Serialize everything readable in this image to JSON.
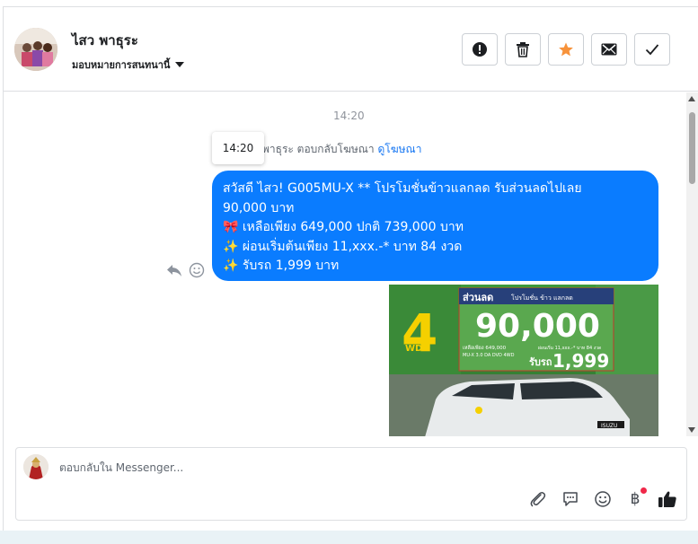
{
  "header": {
    "name": "ไสว พาธุระ",
    "assign_label": "มอบหมายการสนทนานี้",
    "actions": [
      {
        "icon": "alert-icon"
      },
      {
        "icon": "trash-icon"
      },
      {
        "icon": "star-icon"
      },
      {
        "icon": "mail-icon"
      },
      {
        "icon": "check-icon"
      }
    ]
  },
  "thread": {
    "timestamp": "14:20",
    "tooltip_time": "14:20",
    "reply_note_prefix": "พาธุระ ตอบกลับโฆษณา",
    "reply_note_link": "ดูโฆษณา",
    "message_lines": [
      "สวัสดี ไสว! G005MU-X ** โปรโมชั่นข้าวแลกลด รับส่วนลดไปเลย",
      "90,000 บาท",
      "🎀  เหลือเพียง 649,000 ปกติ 739,000 บาท",
      "✨  ผ่อนเริ่มต้นเพียง 11,xxx.-* บาท 84 งวด",
      "✨ รับรถ 1,999 บาท"
    ],
    "ad": {
      "drive_number": "4",
      "drive_label": "WD",
      "discount_label": "ส่วนลด",
      "promo_label": "โปรโมชั่น ข้าว แลกลด",
      "discount_amount": "90,000",
      "price_note": "เหลือเพียง 649,000",
      "model_note": "MU-X 3.0 DA DVD 4WD",
      "installment_note": "ผ่อนเริ่ม 11,xxx.-* บาท 84 งวด",
      "pickup_label": "รับรถ",
      "pickup_amount": "1,999",
      "brand": "ISUZU"
    }
  },
  "composer": {
    "placeholder": "ตอบกลับใน Messenger...",
    "tools": [
      "paperclip-icon",
      "chat-bubble-icon",
      "emoji-icon",
      "baht-icon",
      "thumbs-up-icon"
    ],
    "baht_symbol": "฿"
  },
  "colors": {
    "bubble": "#0a7cff",
    "link": "#1877f2",
    "star": "#f7923a",
    "notification_dot": "#f02849"
  }
}
